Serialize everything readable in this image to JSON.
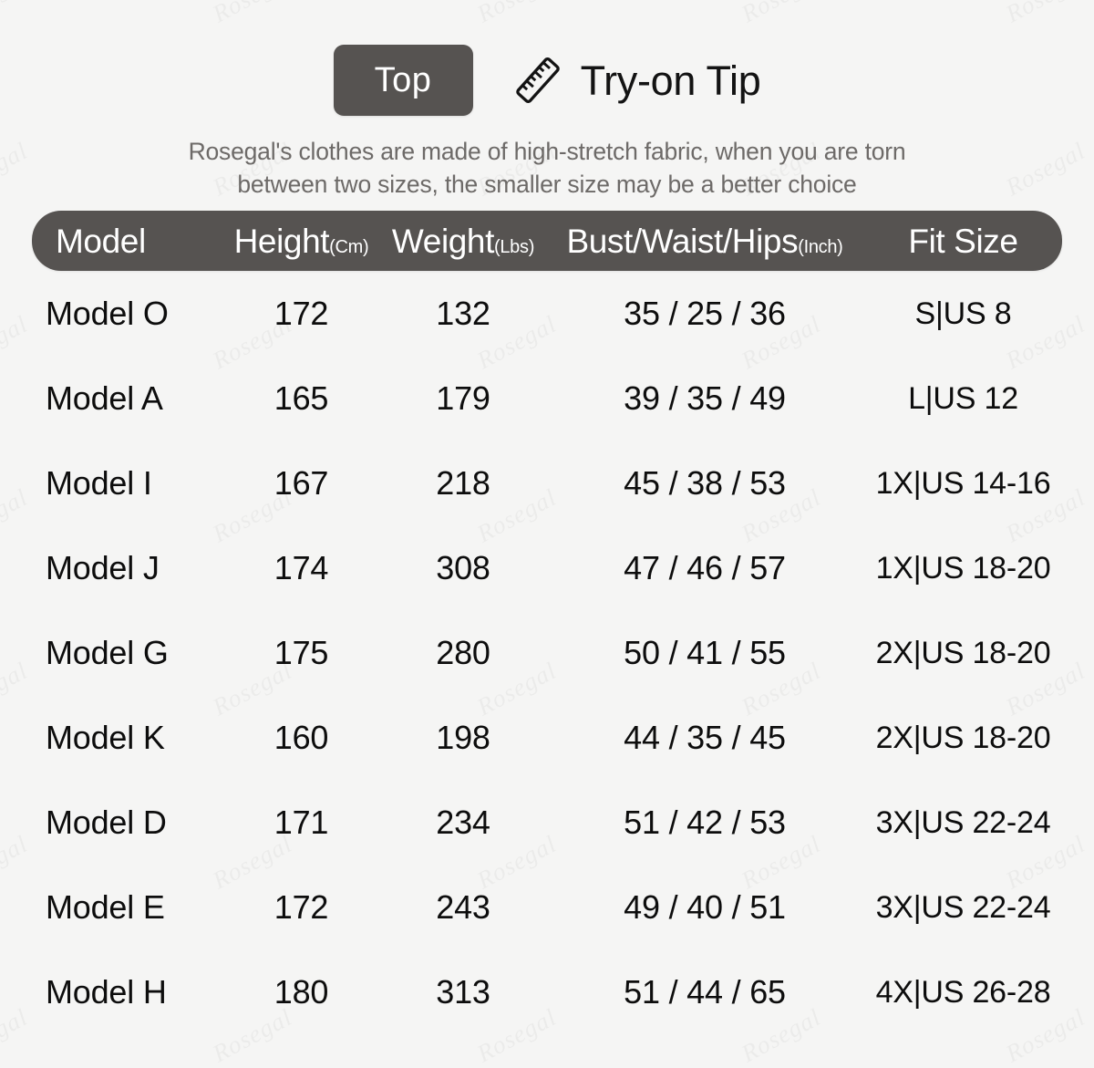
{
  "header": {
    "category_label": "Top",
    "ruler_icon": "ruler-icon",
    "title": "Try-on Tip"
  },
  "subtitle": {
    "line1": "Rosegal's clothes are made of high-stretch fabric, when you are torn",
    "line2": "between two sizes, the smaller size may be a better choice"
  },
  "watermark": {
    "text": "Rosegal"
  },
  "colors": {
    "background": "#f5f5f4",
    "header_bar": "#565351",
    "header_text": "#ffffff",
    "body_text": "#0d0d0d",
    "subtitle_text": "#6d6a68"
  },
  "table": {
    "columns": [
      {
        "label": "Model",
        "unit": ""
      },
      {
        "label": "Height",
        "unit": "(Cm)"
      },
      {
        "label": "Weight",
        "unit": "(Lbs)"
      },
      {
        "label": "Bust/Waist/Hips",
        "unit": "(Inch)"
      },
      {
        "label": "Fit Size",
        "unit": ""
      }
    ],
    "rows": [
      {
        "model": "Model O",
        "height": "172",
        "weight": "132",
        "bwh": "35 / 25 / 36",
        "fit": "S|US 8"
      },
      {
        "model": "Model A",
        "height": "165",
        "weight": "179",
        "bwh": "39 / 35 / 49",
        "fit": "L|US 12"
      },
      {
        "model": "Model I",
        "height": "167",
        "weight": "218",
        "bwh": "45 / 38 / 53",
        "fit": "1X|US 14-16"
      },
      {
        "model": "Model J",
        "height": "174",
        "weight": "308",
        "bwh": "47 / 46 / 57",
        "fit": "1X|US 18-20"
      },
      {
        "model": "Model G",
        "height": "175",
        "weight": "280",
        "bwh": "50 / 41 / 55",
        "fit": "2X|US 18-20"
      },
      {
        "model": "Model K",
        "height": "160",
        "weight": "198",
        "bwh": "44 / 35 / 45",
        "fit": "2X|US 18-20"
      },
      {
        "model": "Model D",
        "height": "171",
        "weight": "234",
        "bwh": "51 / 42 / 53",
        "fit": "3X|US 22-24"
      },
      {
        "model": "Model E",
        "height": "172",
        "weight": "243",
        "bwh": "49 / 40 / 51",
        "fit": "3X|US 22-24"
      },
      {
        "model": "Model H",
        "height": "180",
        "weight": "313",
        "bwh": "51 / 44 / 65",
        "fit": "4X|US 26-28"
      }
    ]
  }
}
